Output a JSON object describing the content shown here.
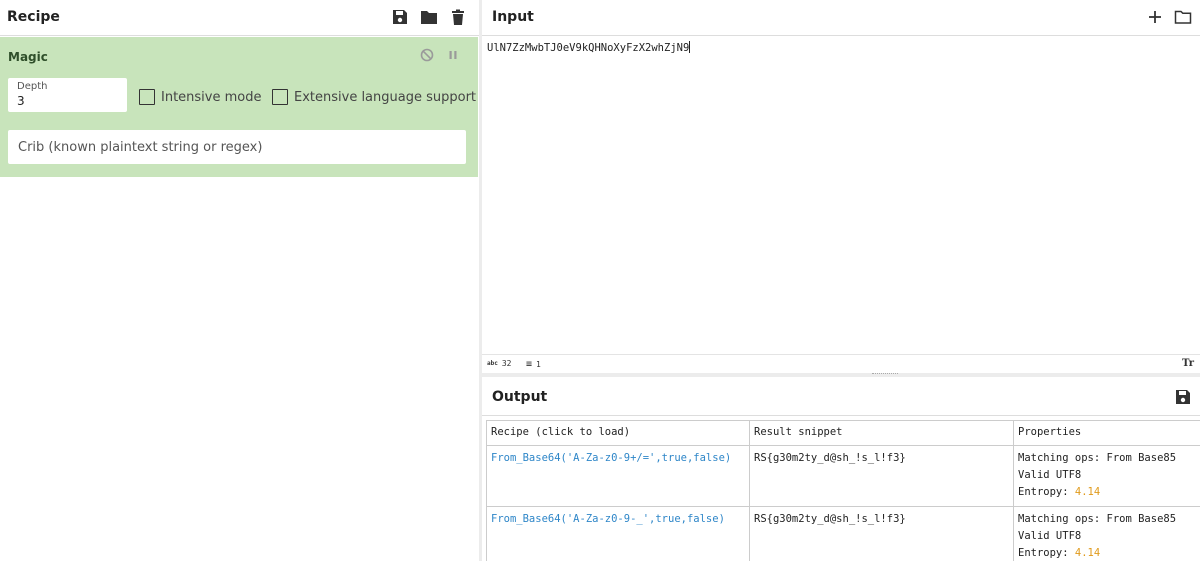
{
  "recipe": {
    "title": "Recipe",
    "icons": [
      "save-icon",
      "folder-icon",
      "trash-icon"
    ]
  },
  "magic": {
    "name": "Magic",
    "depth_label": "Depth",
    "depth_value": "3",
    "intensive_label": "Intensive mode",
    "extensive_label": "Extensive language support",
    "intensive_checked": false,
    "extensive_checked": false,
    "crib_placeholder": "Crib (known plaintext string or regex)"
  },
  "input": {
    "title": "Input",
    "text": "UlN7ZzMwbTJ0eV9kQHNoXyFzX2whZjN9",
    "length": "32",
    "lines": "1",
    "length_icon": "abc",
    "lines_icon": "≡",
    "format_icon": "Tr"
  },
  "output": {
    "title": "Output",
    "columns": [
      "Recipe (click to load)",
      "Result snippet",
      "Properties"
    ],
    "rows": [
      {
        "recipe": "From_Base64('A-Za-z0-9+/=',true,false)",
        "snippet": "RS{g30m2ty_d@sh_!s_l!f3}",
        "ops": "Matching ops: From Base85",
        "utf8": "Valid UTF8",
        "entropy_label": "Entropy: ",
        "entropy": "4.14"
      },
      {
        "recipe": "From_Base64('A-Za-z0-9-_',true,false)",
        "snippet": "RS{g30m2ty_d@sh_!s_l!f3}",
        "ops": "Matching ops: From Base85",
        "utf8": "Valid UTF8",
        "entropy_label": "Entropy: ",
        "entropy": "4.14"
      }
    ]
  },
  "colors": {
    "op_background": "#c8e4bb",
    "link": "#2e86c8",
    "entropy": "#e09a1b"
  }
}
